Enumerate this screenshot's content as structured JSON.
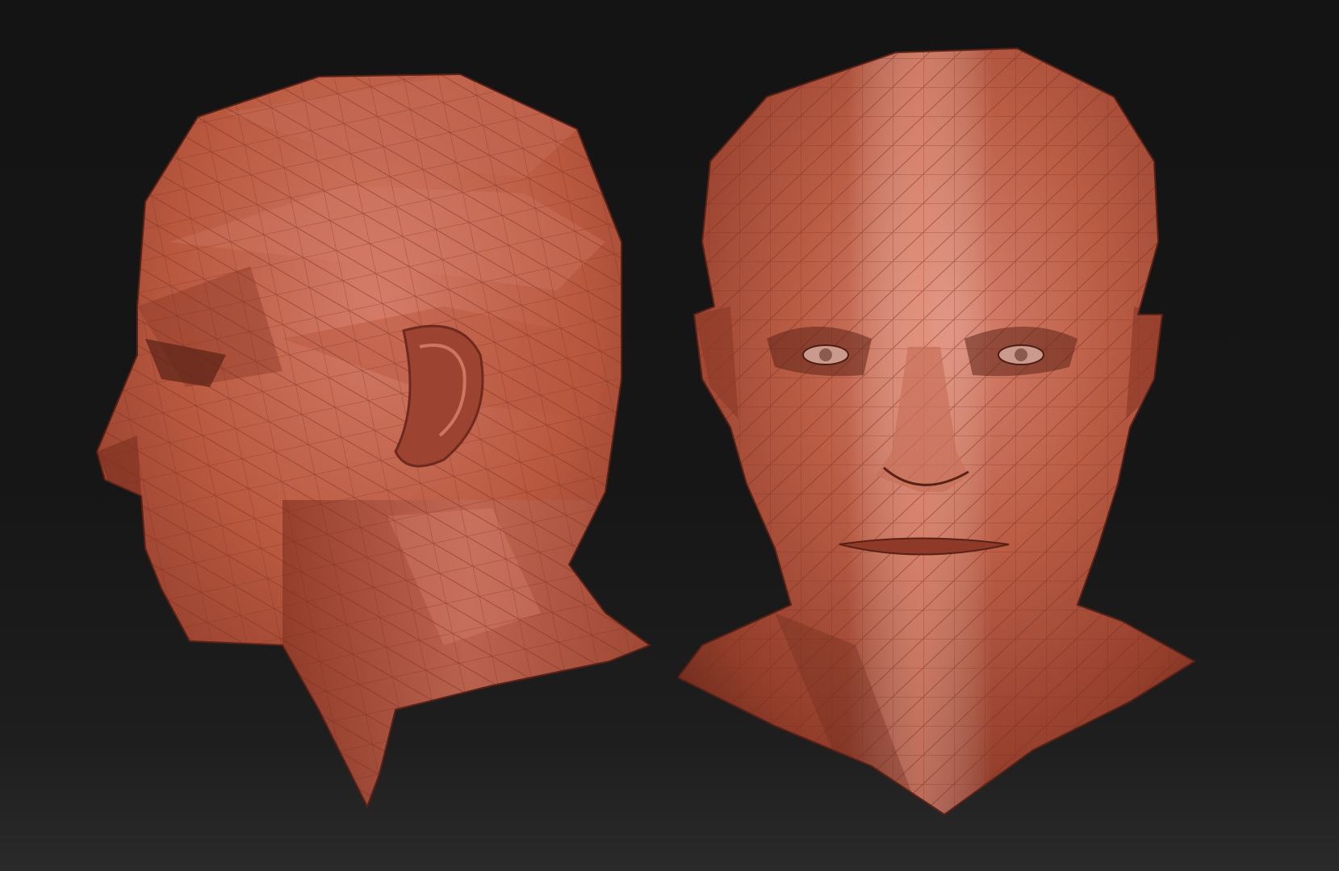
{
  "viewport": {
    "background_top": "#141414",
    "background_bottom": "#2a2a2a"
  },
  "material": {
    "base_color": "#b5543f",
    "highlight_color": "#e08a78",
    "shadow_color": "#6e2a1e",
    "wire_color": "#8a3424"
  },
  "models": [
    {
      "view": "side",
      "description_icon": "head-profile-left"
    },
    {
      "view": "front",
      "description_icon": "head-front"
    }
  ]
}
